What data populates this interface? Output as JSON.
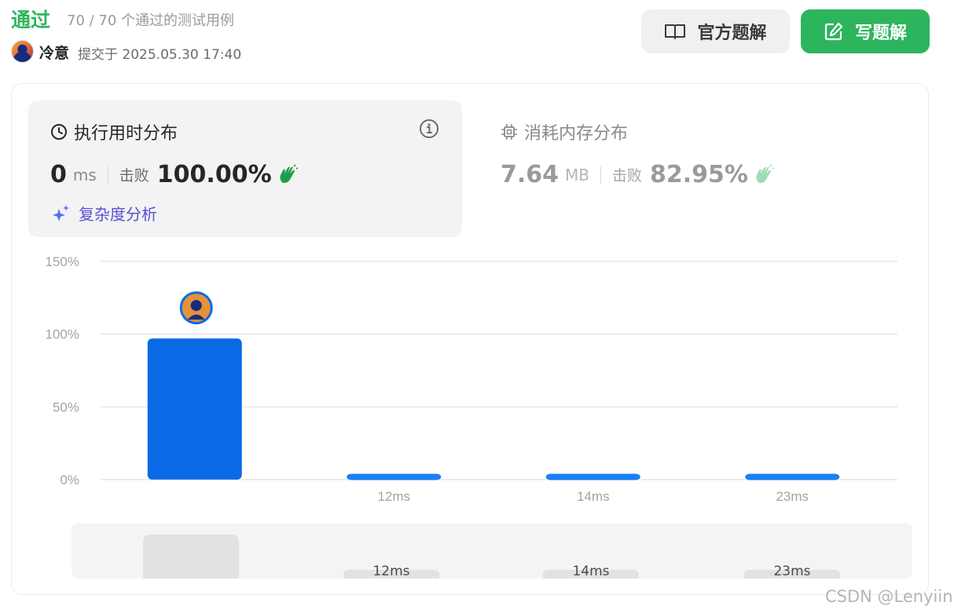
{
  "header": {
    "status": "通过",
    "testcases": "70 / 70 个通过的测试用例",
    "author": "冷意",
    "submitted": "提交于 2025.05.30 17:40"
  },
  "buttons": {
    "official_label": "官方题解",
    "write_label": "写题解"
  },
  "runtime": {
    "title": "执行用时分布",
    "value": "0",
    "unit": "ms",
    "beats_label": "击败",
    "beats_value": "100.00%",
    "complexity_label": "复杂度分析"
  },
  "memory": {
    "title": "消耗内存分布",
    "value": "7.64",
    "unit": "MB",
    "beats_label": "击败",
    "beats_value": "82.95%"
  },
  "colors": {
    "accent_green": "#2db55d",
    "bar_blue": "#0a6ae6",
    "complexity_purple": "#5a4fd8"
  },
  "chart_data": {
    "type": "bar",
    "categories": [
      "0ms",
      "12ms",
      "14ms",
      "23ms"
    ],
    "tick_labels": [
      "",
      "12ms",
      "14ms",
      "23ms"
    ],
    "values": [
      97,
      4,
      4,
      4
    ],
    "ylim": [
      0,
      150
    ],
    "yticks": [
      "0%",
      "50%",
      "100%",
      "150%"
    ],
    "grid": true,
    "highlighted_category": "0ms"
  },
  "minimap": {
    "labels": [
      "12ms",
      "14ms",
      "23ms"
    ]
  },
  "watermark": "CSDN @Lenyiin"
}
